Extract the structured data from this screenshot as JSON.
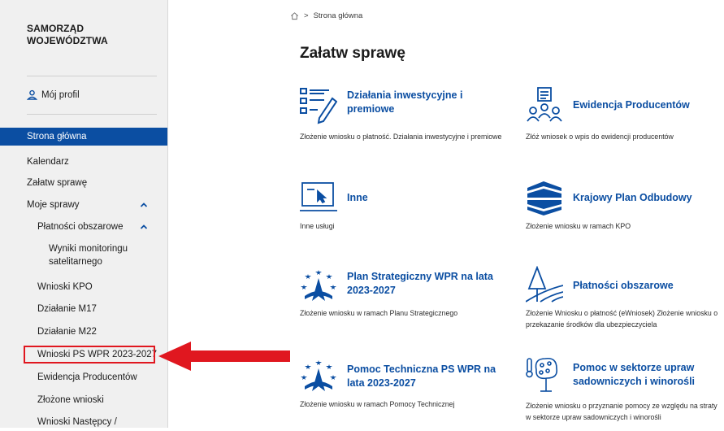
{
  "sidebar": {
    "brand_line1": "SAMORZĄD",
    "brand_line2": "WOJEWÓDZTWA",
    "profile_label": "Mój profil",
    "items": [
      {
        "label": "Strona główna"
      },
      {
        "label": "Kalendarz"
      },
      {
        "label": "Załatw sprawę"
      },
      {
        "label": "Moje sprawy"
      },
      {
        "label": "Płatności obszarowe"
      },
      {
        "label": "Wyniki monitoringu satelitarnego"
      },
      {
        "label": "Wnioski KPO"
      },
      {
        "label": "Działanie M17"
      },
      {
        "label": "Działanie M22"
      },
      {
        "label": "Wnioski PS WPR 2023-2027"
      },
      {
        "label": "Ewidencja Producentów"
      },
      {
        "label": "Złożone wnioski"
      },
      {
        "label": "Wnioski Następcy /"
      }
    ]
  },
  "breadcrumb": {
    "current": "Strona główna"
  },
  "page": {
    "title": "Załatw sprawę"
  },
  "tiles": [
    {
      "name": "Działania inwestycyjne i premiowe",
      "desc": "Złożenie wniosku o płatność. Działania inwestycyjne i premiowe",
      "icon": "document-pen-icon"
    },
    {
      "name": "Ewidencja Producentów",
      "desc": "Złóż wniosek o wpis do ewidencji producentów",
      "icon": "people-group-icon"
    },
    {
      "name": "Inne",
      "desc": "Inne usługi",
      "icon": "laptop-cursor-icon"
    },
    {
      "name": "Krajowy Plan Odbudowy",
      "desc": "Złożenie wniosku w ramach KPO",
      "icon": "kpo-logo-icon"
    },
    {
      "name": "Plan Strategiczny WPR na lata 2023-2027",
      "desc": "Złożenie wniosku w ramach Planu Strategicznego",
      "icon": "eu-stars-emblem-icon"
    },
    {
      "name": "Płatności obszarowe",
      "desc": "Złożenie Wniosku o płatność (eWniosek) Złożenie wniosku o przekazanie środków dla ubezpieczyciela",
      "icon": "field-tree-icon"
    },
    {
      "name": "Pomoc Techniczna PS WPR na lata 2023-2027",
      "desc": "Złożenie wniosku w ramach Pomocy Technicznej",
      "icon": "eu-stars-emblem-icon"
    },
    {
      "name": "Pomoc w sektorze upraw sadowniczych i winorośli",
      "desc": "Złożenie wniosku o przyznanie pomocy ze względu na straty w sektorze upraw sadowniczych i winorośli",
      "icon": "fruit-tree-thermometer-icon"
    }
  ],
  "colors": {
    "accent": "#0b4ea2",
    "highlight": "#e0171f"
  }
}
